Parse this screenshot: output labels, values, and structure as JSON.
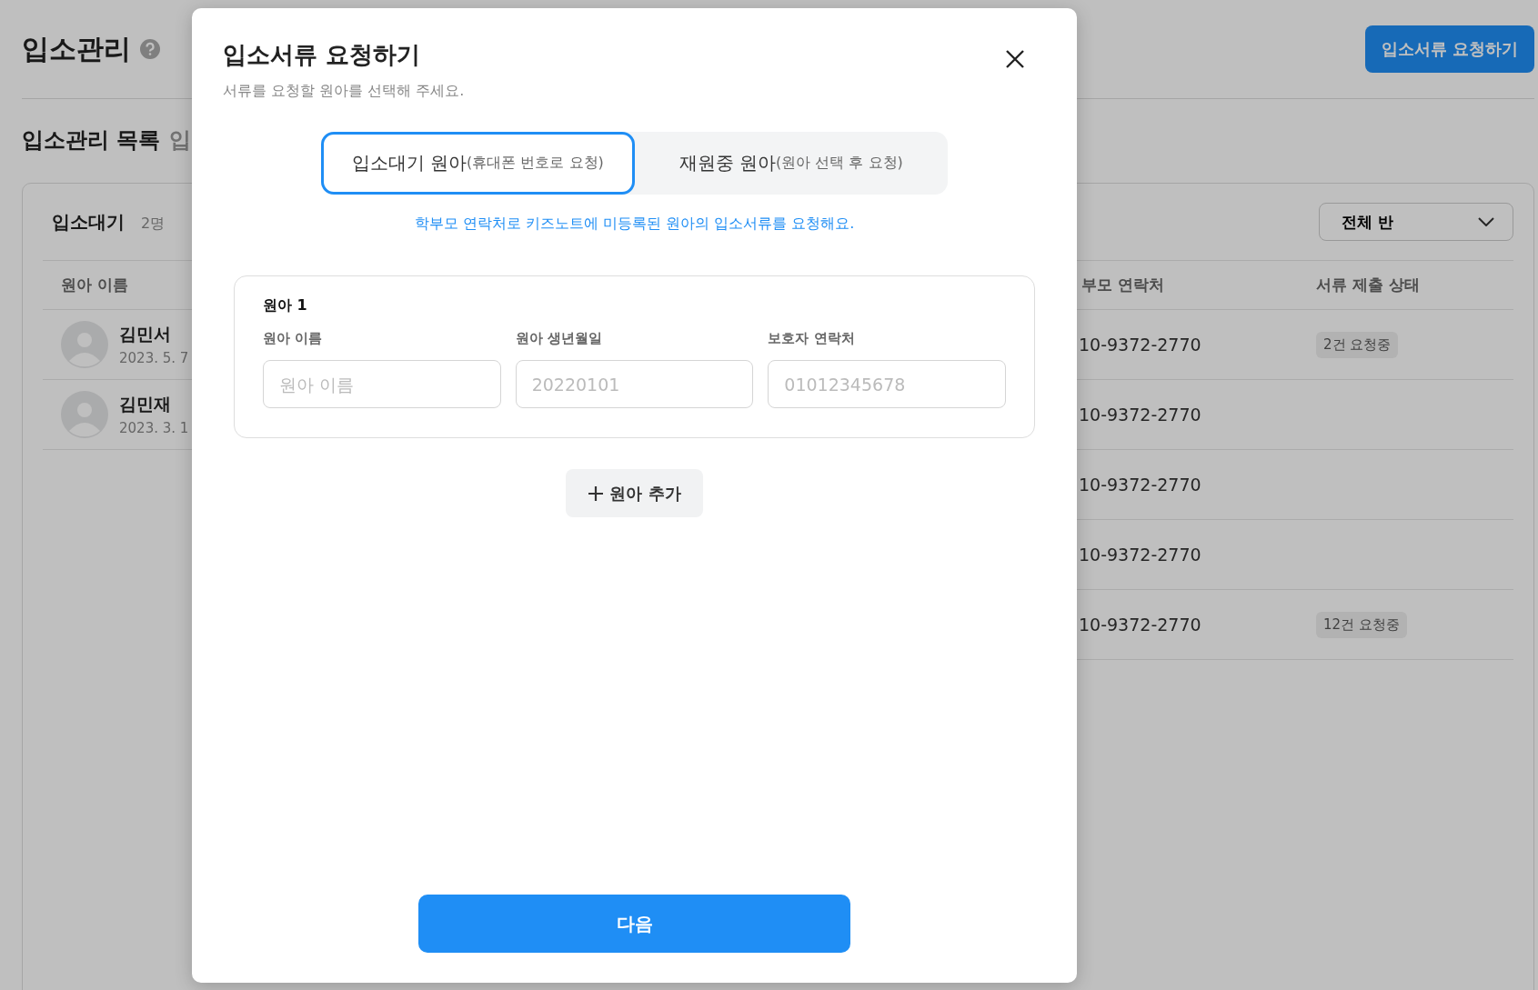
{
  "page": {
    "title": "입소관리",
    "action_button": "입소서류 요청하기",
    "section_title": "입소관리 목록",
    "section_tab": "입"
  },
  "waiting": {
    "title": "입소대기",
    "count": "2명",
    "class_filter": "전체 반",
    "columns": [
      "원아 이름",
      "부모 연락처",
      "서류 제출 상태"
    ],
    "children": [
      {
        "name": "김민서",
        "birth": "2023. 5. 7"
      },
      {
        "name": "김민재",
        "birth": "2023. 3. 1"
      }
    ],
    "contacts": [
      {
        "phone": "10-9372-2770",
        "status": "2건 요청중"
      },
      {
        "phone": "10-9372-2770"
      },
      {
        "phone": "10-9372-2770"
      },
      {
        "phone": "10-9372-2770"
      },
      {
        "phone": "10-9372-2770",
        "status": "12건 요청중"
      }
    ]
  },
  "dialog": {
    "title": "입소서류 요청하기",
    "subtitle": "서류를 요청할 원아를 선택해 주세요.",
    "tabs": [
      {
        "label": "입소대기 원아",
        "hint": "(휴대폰 번호로 요청)",
        "selected": true
      },
      {
        "label": "재원중 원아",
        "hint": "(원아 선택 후 요청)",
        "selected": false
      }
    ],
    "notice": "학부모 연락처로 키즈노트에 미등록된 원아의 입소서류를 요청해요.",
    "child_forms": [
      {
        "title": "원아 1",
        "fields": [
          {
            "label": "원아 이름",
            "placeholder": "원아 이름"
          },
          {
            "label": "원아 생년월일",
            "placeholder": "20220101"
          },
          {
            "label": "보호자 연락처",
            "placeholder": "01012345678"
          }
        ]
      }
    ],
    "add_button": "원아 추가",
    "next_button": "다음"
  }
}
